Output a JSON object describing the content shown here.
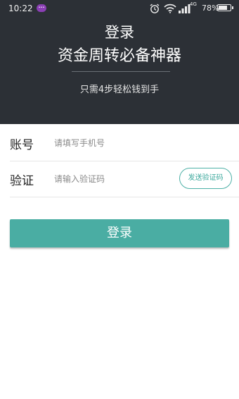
{
  "status_bar": {
    "time": "10:22",
    "network": "4G",
    "battery": "78%",
    "battery_level": 0.78
  },
  "header": {
    "title": "登录",
    "subtitle": "资金周转必备神器",
    "tagline": "只需4步轻松钱到手"
  },
  "form": {
    "account": {
      "label": "账号",
      "placeholder": "请填写手机号",
      "value": ""
    },
    "code": {
      "label": "验证",
      "placeholder": "请输入验证码",
      "value": ""
    },
    "send_code_label": "发送验证码"
  },
  "login_label": "登录",
  "colors": {
    "header_bg": "#2c3036",
    "accent": "#4aada3"
  }
}
